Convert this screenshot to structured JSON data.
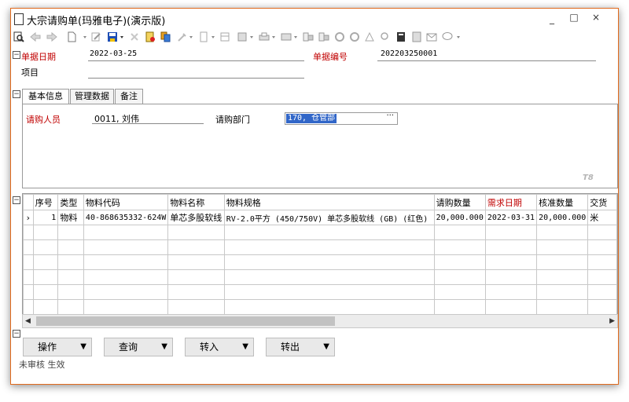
{
  "window": {
    "title": "大宗请购单(玛雅电子)(演示版)",
    "controls": {
      "minimize": "_",
      "maximize": "□",
      "close": "×"
    }
  },
  "toolbar": {
    "icons": [
      "preview-icon",
      "back-icon",
      "forward-icon",
      "new-icon",
      "edit-icon",
      "save-icon",
      "delete-icon",
      "audit-icon",
      "copy-icon",
      "tool-icon",
      "doc-icon",
      "table-icon",
      "image-icon",
      "print-icon",
      "link-icon",
      "link2-icon",
      "refresh-icon",
      "refresh2-icon",
      "tree-icon",
      "find-icon",
      "calc-icon",
      "note-icon",
      "mail-icon",
      "chat-icon"
    ]
  },
  "header": {
    "date_label": "单据日期",
    "date_value": "2022-03-25",
    "number_label": "单据编号",
    "number_value": "202203250001",
    "project_label": "项目",
    "project_value": ""
  },
  "tabs": [
    {
      "label": "基本信息",
      "active": true
    },
    {
      "label": "管理数据",
      "active": false
    },
    {
      "label": "备注",
      "active": false
    }
  ],
  "basic": {
    "requester_label": "请购人员",
    "requester_value": "0011, 刘伟",
    "dept_label": "请购部门",
    "dept_value": "170, 仓管部",
    "dept_more": "···",
    "watermark": "T8"
  },
  "grid": {
    "columns": [
      "序号",
      "类型",
      "物料代码",
      "物料名称",
      "物料规格",
      "请购数量",
      "需求日期",
      "核准数量",
      "交货"
    ],
    "rows": [
      {
        "marker": "›",
        "seq": "1",
        "type": "物料",
        "code": "40-868635332-624W",
        "name": "单芯多股软线",
        "spec": "RV-2.0平方 (450/750V) 单芯多股软线 (GB) (红色)",
        "qty": "20,000.000",
        "date": "2022-03-31",
        "approved": "20,000.000",
        "unit": "米"
      }
    ],
    "scroll_left": "◀",
    "scroll_right": "▶"
  },
  "actions": [
    {
      "label": "操作"
    },
    {
      "label": "查询"
    },
    {
      "label": "转入"
    },
    {
      "label": "转出"
    }
  ],
  "status": "未审核 生效"
}
